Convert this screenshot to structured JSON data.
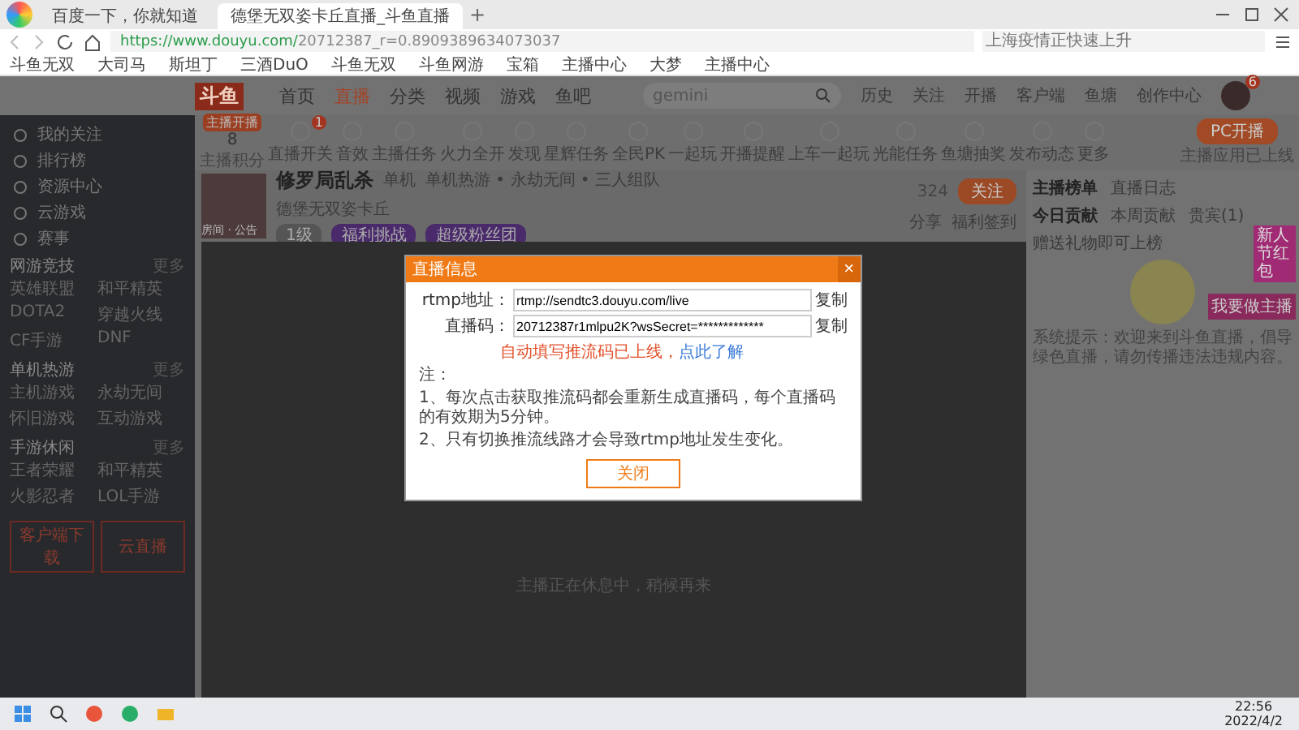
{
  "browser": {
    "tabs": [
      {
        "title": "百度一下，你就知道",
        "selected": false
      },
      {
        "title": "德堡无双姿卡丘直播_斗鱼直播",
        "selected": true
      }
    ],
    "new_tab": "+",
    "url_host": "https://www.douyu.com/",
    "url_path": "20712387_r=0.8909389634073037",
    "search_placeholder": "上海疫情正快速上升",
    "bookmarks": [
      "斗鱼无双",
      "大司马",
      "斯坦丁",
      "三酒DuO",
      "斗鱼无双",
      "斗鱼网游",
      "宝箱",
      "主播中心",
      "大梦",
      "主播中心"
    ]
  },
  "site": {
    "logo": "斗鱼",
    "nav": [
      {
        "label": "首页",
        "selected": false
      },
      {
        "label": "直播",
        "selected": true
      },
      {
        "label": "分类",
        "selected": false
      },
      {
        "label": "视频",
        "selected": false
      },
      {
        "label": "游戏",
        "selected": false
      },
      {
        "label": "鱼吧",
        "selected": false
      }
    ],
    "search_value": "gemini",
    "top_links": [
      "历史",
      "关注",
      "开播",
      "客户端",
      "鱼塘",
      "创作中心"
    ],
    "message_badge": "6"
  },
  "sidebar": {
    "items": [
      "我的关注",
      "排行榜",
      "资源中心",
      "云游戏",
      "赛事"
    ],
    "sections": [
      {
        "title": "网游竞技",
        "more": "更多",
        "games": [
          "英雄联盟",
          "和平精英",
          "DOTA2",
          "穿越火线",
          "CF手游",
          "DNF"
        ]
      },
      {
        "title": "单机热游",
        "more": "更多",
        "games": [
          "主机游戏",
          "永劫无间",
          "怀旧游戏",
          "互动游戏"
        ]
      },
      {
        "title": "手游休闲",
        "more": "更多",
        "games": [
          "王者荣耀",
          "和平精英",
          "火影忍者",
          "LOL手游"
        ]
      }
    ],
    "buttons": [
      "客户端下载",
      "云直播"
    ]
  },
  "toolbar": {
    "score_badge": "主播开播",
    "score": "8",
    "score_label": "主播积分",
    "switch_badge": "1",
    "tools": [
      "直播开关",
      "音效",
      "主播任务",
      "火力全开",
      "发现",
      "星辉任务",
      "全民PK",
      "一起玩",
      "开播提醒",
      "上车一起玩",
      "光能任务",
      "鱼塘抽奖",
      "发布动态",
      "更多"
    ],
    "pc_button": "PC开播",
    "pc_note": "主播应用已上线"
  },
  "streamer": {
    "title": "修罗局乱杀",
    "category": "单机",
    "tags": "单机热游 • 永劫无间 • 三人组队",
    "name": "德堡无双姿卡丘",
    "avatar_label": "房间 · 公告",
    "chips": [
      "1级",
      "福利挑战",
      "超级粉丝团"
    ],
    "count": "324",
    "follow": "关注",
    "share": "分享",
    "report": "福利签到"
  },
  "ranking": {
    "tabs": [
      {
        "label": "主播榜单",
        "selected": true
      },
      {
        "label": "直播日志",
        "selected": false
      }
    ],
    "subtabs": [
      {
        "label": "今日贡献",
        "selected": true
      },
      {
        "label": "本周贡献",
        "selected": false
      },
      {
        "label": "贵宾(1)",
        "selected": false
      }
    ],
    "hint": "赠送礼物即可上榜",
    "badge": "新人节红包",
    "shop": "我要做主播",
    "notice": "系统提示：欢迎来到斗鱼直播，倡导绿色直播，请勿传播违法违规内容。"
  },
  "player": {
    "status": "主播正在休息中，稍候再来"
  },
  "modal": {
    "title": "直播信息",
    "close": "×",
    "fields": [
      {
        "label": "rtmp地址：",
        "value": "rtmp://sendtc3.douyu.com/live",
        "copy": "复制"
      },
      {
        "label": "直播码：",
        "value": "20712387r1mlpu2K?wsSecret=*************",
        "copy": "复制"
      }
    ],
    "warning": "自动填写推流码已上线，",
    "link": "点此了解",
    "notes": [
      "注：",
      "1、每次点击获取推流码都会重新生成直播码，每个直播码的有效期为5分钟。",
      "2、只有切换推流线路才会导致rtmp地址发生变化。"
    ],
    "button": "关闭"
  },
  "taskbar": {
    "time": "22:56",
    "date": "2022/4/2"
  }
}
